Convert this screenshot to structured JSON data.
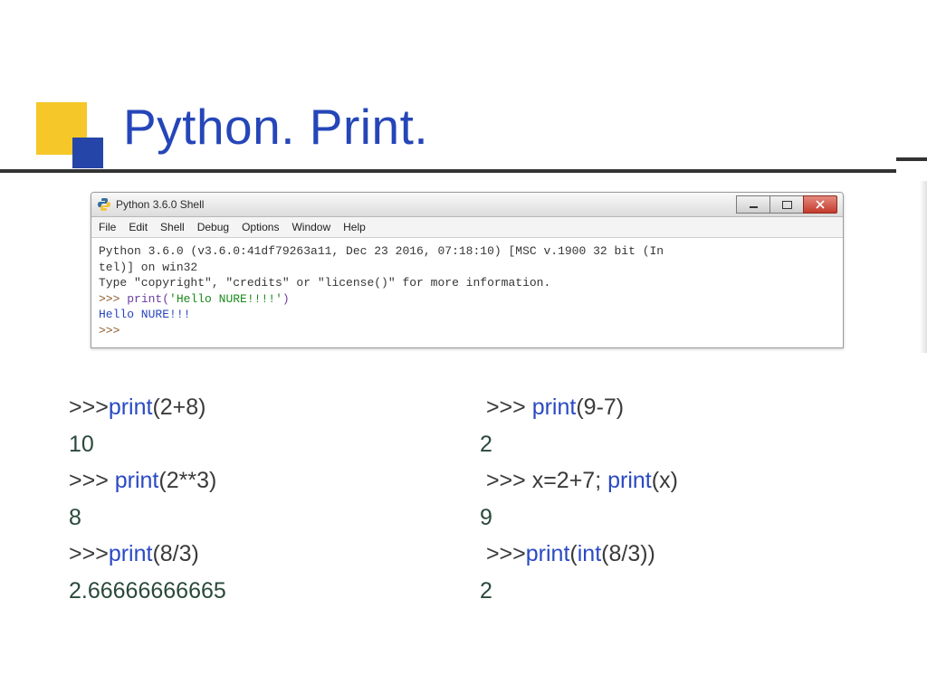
{
  "title": "Python. Print.",
  "window": {
    "title": "Python 3.6.0 Shell",
    "menu": [
      "File",
      "Edit",
      "Shell",
      "Debug",
      "Options",
      "Window",
      "Help"
    ],
    "banner_line1": "Python 3.6.0 (v3.6.0:41df79263a11, Dec 23 2016, 07:18:10) [MSC v.1900 32 bit (In",
    "banner_line2": "tel)] on win32",
    "banner_line3": "Type \"copyright\", \"credits\" or \"license()\" for more information.",
    "prompt": ">>>",
    "call_print": "print",
    "call_arg": "'Hello NURE!!!!'",
    "output": "Hello NURE!!!"
  },
  "left": {
    "l1a": ">>>",
    "l1b": "print",
    "l1c": "(2+8)",
    "l2": "10",
    "l3a": ">>> ",
    "l3b": "print",
    "l3c": "(2**3)",
    "l4": "8",
    "l5a": ">>>",
    "l5b": "print",
    "l5c": "(8/3)",
    "l6": "2.66666666665"
  },
  "right": {
    "r1a": ">>> ",
    "r1b": "print",
    "r1c": "(9-7)",
    "r2": "2",
    "r3a": ">>> x=2+7; ",
    "r3b": "print",
    "r3c": "(x)",
    "r4": "9",
    "r5a": ">>>",
    "r5b": "print",
    "r5c": "(",
    "r5d": "int",
    "r5e": "(8/3))",
    "r6": "2"
  }
}
